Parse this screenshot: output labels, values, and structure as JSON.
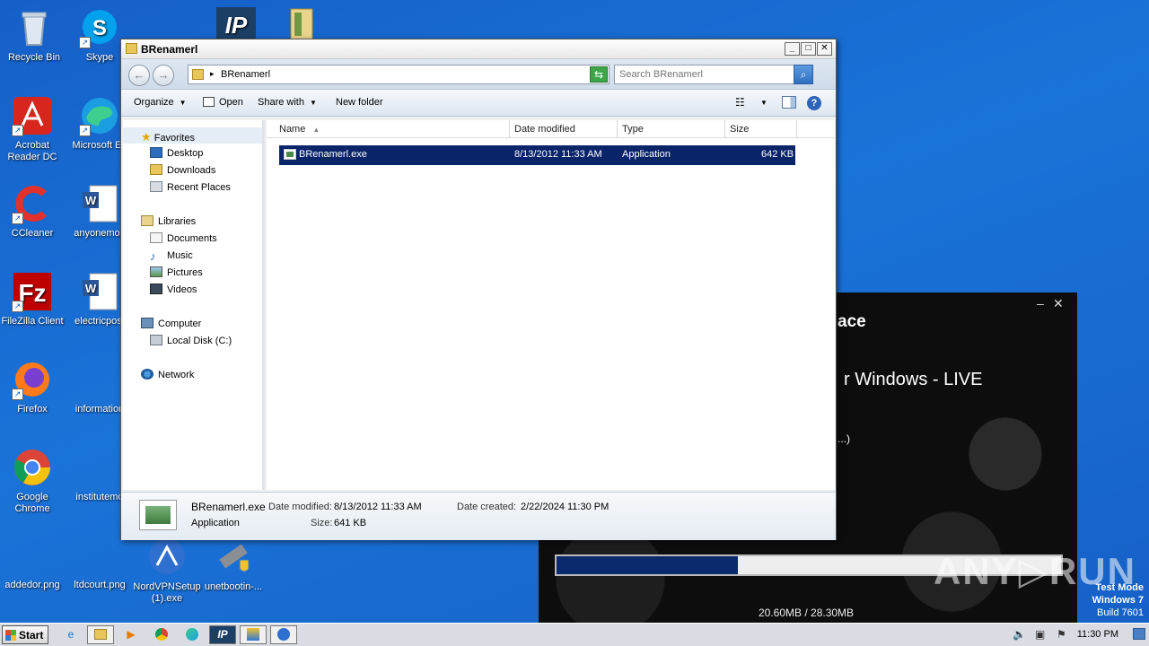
{
  "desktop": {
    "icons": [
      {
        "label": "Recycle Bin"
      },
      {
        "label": "Skype"
      },
      {
        "label": "Acrobat Reader DC"
      },
      {
        "label": "Microsoft Ed"
      },
      {
        "label": "CCleaner"
      },
      {
        "label": "anyonemod"
      },
      {
        "label": "FileZilla Client"
      },
      {
        "label": "electricpost"
      },
      {
        "label": "Firefox"
      },
      {
        "label": "information"
      },
      {
        "label": "Google Chrome"
      },
      {
        "label": "institutemo"
      },
      {
        "label": "addedor.png"
      },
      {
        "label": "ltdcourt.png"
      },
      {
        "label": "NordVPNSetup (1).exe"
      },
      {
        "label": "unetbootin-..."
      }
    ]
  },
  "installer": {
    "title_fragment": "ace",
    "subtitle_fragment": "r Windows - LIVE",
    "status_fragment": "...)",
    "progress_fraction": 0.36,
    "size_text": "20.60MB / 28.30MB",
    "close_glyph": "✕",
    "min_glyph": "–"
  },
  "watermark": {
    "text": "ANY▷RUN"
  },
  "testmode": {
    "line1": "Test Mode",
    "line2": "Windows 7",
    "line3": "Build 7601"
  },
  "explorer": {
    "title": "BRenamerl",
    "address": {
      "path": "BRenamerl"
    },
    "search": {
      "placeholder": "Search BRenamerl"
    },
    "toolbar": {
      "organize": "Organize",
      "open": "Open",
      "share_with": "Share with",
      "new_folder": "New folder",
      "help": "?"
    },
    "nav": {
      "favorites": "Favorites",
      "desktop": "Desktop",
      "downloads": "Downloads",
      "recent_places": "Recent Places",
      "libraries": "Libraries",
      "documents": "Documents",
      "music": "Music",
      "pictures": "Pictures",
      "videos": "Videos",
      "computer": "Computer",
      "local_disk": "Local Disk (C:)",
      "network": "Network"
    },
    "columns": {
      "name": "Name",
      "date_modified": "Date modified",
      "type": "Type",
      "size": "Size"
    },
    "files": [
      {
        "name": "BRenamerl.exe",
        "date_modified": "8/13/2012 11:33 AM",
        "type": "Application",
        "size": "642 KB"
      }
    ],
    "details": {
      "filename": "BRenamerl.exe",
      "filetype": "Application",
      "date_modified_label": "Date modified:",
      "date_modified": "8/13/2012 11:33 AM",
      "date_created_label": "Date created:",
      "date_created": "2/22/2024 11:30 PM",
      "size_label": "Size:",
      "size": "641 KB"
    }
  },
  "taskbar": {
    "start": "Start",
    "clock": "11:30 PM"
  }
}
